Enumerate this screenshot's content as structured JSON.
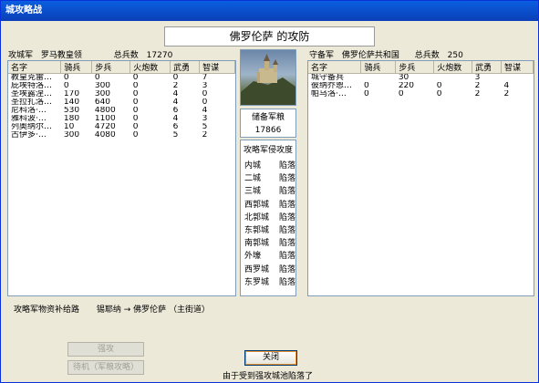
{
  "window_title": "城攻略战",
  "battle_title": "佛罗伦萨 的攻防",
  "attacker": {
    "role": "攻城军",
    "commander": "罗马教皇领",
    "total_label": "总兵数",
    "total": "17270"
  },
  "defender": {
    "role": "守备军",
    "commander": "佛罗伦萨共和国",
    "total_label": "总兵数",
    "total": "250"
  },
  "columns": [
    "名字",
    "骑兵",
    "步兵",
    "火炮数",
    "武勇",
    "智谋"
  ],
  "attacker_units": [
    [
      "教皇克雷…",
      "0",
      "0",
      "0",
      "0",
      "7"
    ],
    [
      "庇埃特洛…",
      "0",
      "300",
      "0",
      "2",
      "3"
    ],
    [
      "圣埃露涅…",
      "170",
      "300",
      "0",
      "4",
      "0"
    ],
    [
      "圣拉扎洛…",
      "140",
      "640",
      "0",
      "4",
      "0"
    ],
    [
      "尼科洛·…",
      "530",
      "4800",
      "0",
      "6",
      "4"
    ],
    [
      "雅科波·…",
      "180",
      "1100",
      "0",
      "4",
      "3"
    ],
    [
      "列奥纳尔…",
      "10",
      "4720",
      "0",
      "6",
      "5"
    ],
    [
      "古伊多·…",
      "300",
      "4080",
      "0",
      "5",
      "2"
    ]
  ],
  "defender_units": [
    [
      "城守备兵",
      "",
      "30",
      "",
      "3",
      ""
    ],
    [
      "彼纳乔恩…",
      "0",
      "220",
      "0",
      "2",
      "4"
    ],
    [
      "帕乌洛·…",
      "0",
      "0",
      "0",
      "2",
      "2"
    ]
  ],
  "reserve": {
    "label": "储备军粮",
    "value": "17866"
  },
  "siege": {
    "header": "攻略军侵攻度",
    "rows": [
      [
        "内城",
        "陷落"
      ],
      [
        "二城",
        "陷落"
      ],
      [
        "三城",
        "陷落"
      ],
      [
        "西郭城",
        "陷落"
      ],
      [
        "北郭城",
        "陷落"
      ],
      [
        "东郭城",
        "陷落"
      ],
      [
        "南郭城",
        "陷落"
      ],
      [
        "外壕",
        "陷落"
      ],
      [
        "西罗城",
        "陷落"
      ],
      [
        "东罗城",
        "陷落"
      ]
    ]
  },
  "supply": {
    "label": "攻略军物资补给路",
    "route": "锡耶纳 → 佛罗伦萨 （主街道）"
  },
  "buttons": {
    "assault": "强攻",
    "wait": "待机（军粮攻略）",
    "close": "关闭"
  },
  "status_text": "由于受到强攻城池陷落了"
}
